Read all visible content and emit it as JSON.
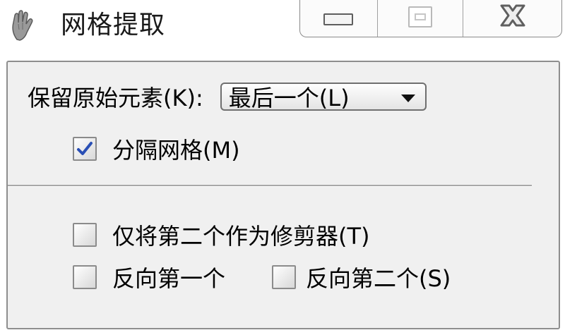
{
  "window": {
    "title": "网格提取",
    "icon": "hand-icon"
  },
  "title_buttons": {
    "minimize": "minimize-icon",
    "maximize": "maximize-icon",
    "close": "close-icon",
    "close_color": "#666666"
  },
  "options": {
    "keep_original_label": "保留原始元素(K):",
    "keep_original_value": "最后一个(L)",
    "separate_grid_label": "分隔网格(M)",
    "separate_grid_checked": true,
    "only_second_trimmer_label": "仅将第二个作为修剪器(T)",
    "only_second_trimmer_checked": false,
    "reverse_first_label": "反向第一个",
    "reverse_first_checked": false,
    "reverse_second_label": "反向第二个(S)",
    "reverse_second_checked": false
  },
  "colors": {
    "dialog_bg": "#f0f0f0",
    "checkmark": "#2a4fb5"
  }
}
